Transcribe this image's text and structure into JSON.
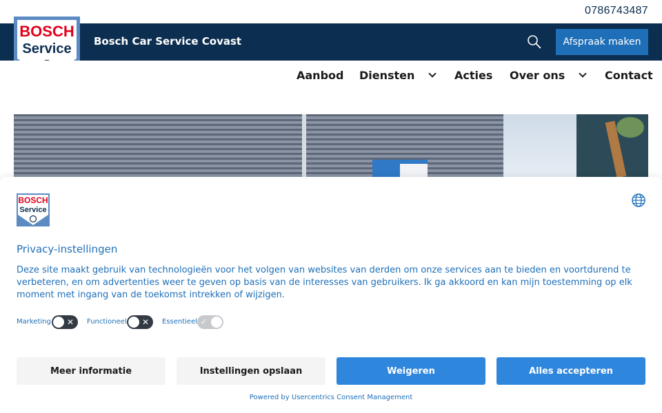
{
  "topbar": {
    "phone": "0786743487"
  },
  "header": {
    "logo_text_1": "BOSCH",
    "logo_text_2": "Service",
    "site_title": "Bosch Car Service Covast",
    "appointment_label": "Afspraak maken"
  },
  "nav": {
    "items": [
      {
        "label": "Aanbod"
      },
      {
        "label": "Diensten"
      },
      {
        "label": "Acties"
      },
      {
        "label": "Over ons"
      },
      {
        "label": "Contact"
      }
    ]
  },
  "consent": {
    "logo_text_1": "BOSCH",
    "logo_text_2": "Service",
    "title": "Privacy-instellingen",
    "text": "Deze site maakt gebruik van technologieën voor het volgen van websites van derden om onze services aan te bieden en voortdurend te verbeteren, en om advertenties weer te geven op basis van de interesses van gebruikers. Ik ga akkoord en kan mijn toestemming op elk moment met ingang van de toekomst intrekken of wijzigen.",
    "toggles": [
      {
        "label": "Marketing",
        "state": "off"
      },
      {
        "label": "Functioneel",
        "state": "off"
      },
      {
        "label": "Essentieel",
        "state": "on-locked"
      }
    ],
    "buttons": {
      "more_info": "Meer informatie",
      "save_settings": "Instellingen opslaan",
      "deny": "Weigeren",
      "accept_all": "Alles accepteren"
    },
    "powered_by": "Powered by Usercentrics Consent Management"
  },
  "colors": {
    "header_bg": "#0c2e50",
    "accent": "#1e6fb8",
    "button_blue": "#2f86dd",
    "logo_red": "#e2001a"
  },
  "icons": {
    "search": "search-icon",
    "globe": "globe-icon",
    "chevron": "chevron-down-icon"
  }
}
